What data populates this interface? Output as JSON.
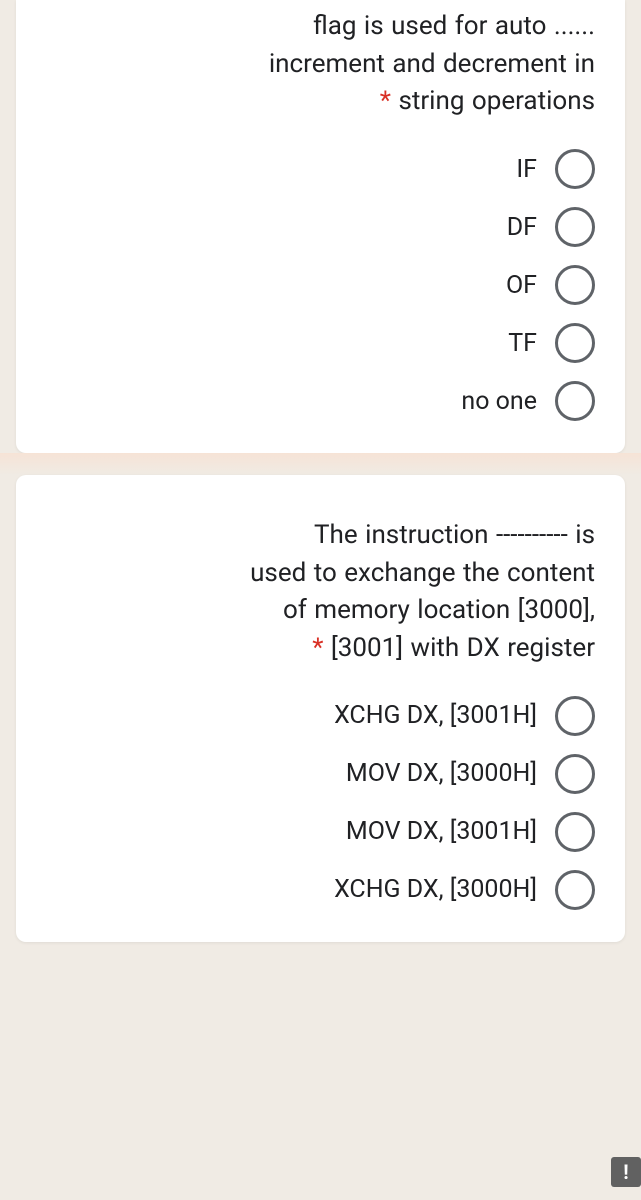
{
  "q1": {
    "text_part1": "flag is used for auto ......",
    "text_part2": "increment and decrement in",
    "text_part3": "string operations",
    "options": [
      "IF",
      "DF",
      "OF",
      "TF",
      "no one"
    ]
  },
  "q2": {
    "text_part1": "The instruction ---------- is",
    "text_part2": "used to exchange the content",
    "text_part3": "of memory location [3000],",
    "text_part4": "[3001] with DX register",
    "options": [
      "XCHG DX, [3001H]",
      "MOV DX, [3000H]",
      "MOV DX, [3001H]",
      "XCHG DX, [3000H]"
    ]
  },
  "asterisk": "*",
  "alert": "!"
}
